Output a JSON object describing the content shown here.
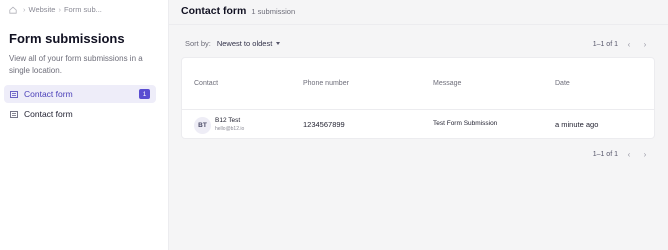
{
  "breadcrumb": {
    "items": [
      "Website",
      "Form sub..."
    ]
  },
  "sidebar": {
    "title": "Form submissions",
    "description": "View all of your form submissions in a single location.",
    "items": [
      {
        "label": "Contact form",
        "badge": "1",
        "active": true
      },
      {
        "label": "Contact form"
      }
    ]
  },
  "main": {
    "title": "Contact form",
    "subtitle": "1 submission",
    "sort": {
      "label": "Sort by:",
      "value": "Newest to oldest"
    },
    "pagination_top": {
      "text": "1–1 of 1",
      "prev_icon": "chevron-left-icon",
      "next_icon": "chevron-right-icon"
    },
    "pagination_bottom": {
      "text": "1–1 of 1"
    },
    "table": {
      "columns": [
        "Contact",
        "Phone number",
        "Message",
        "Date"
      ],
      "rows": [
        {
          "avatar": "BT",
          "name": "B12 Test",
          "email": "hello@b12.io",
          "phone": "1234567899",
          "message": "Test Form Submission",
          "date": "a minute ago"
        }
      ]
    }
  },
  "colors": {
    "accent": "#5a4dd1",
    "active_bg": "#eeedf9",
    "page_bg": "#f5f5f6"
  }
}
